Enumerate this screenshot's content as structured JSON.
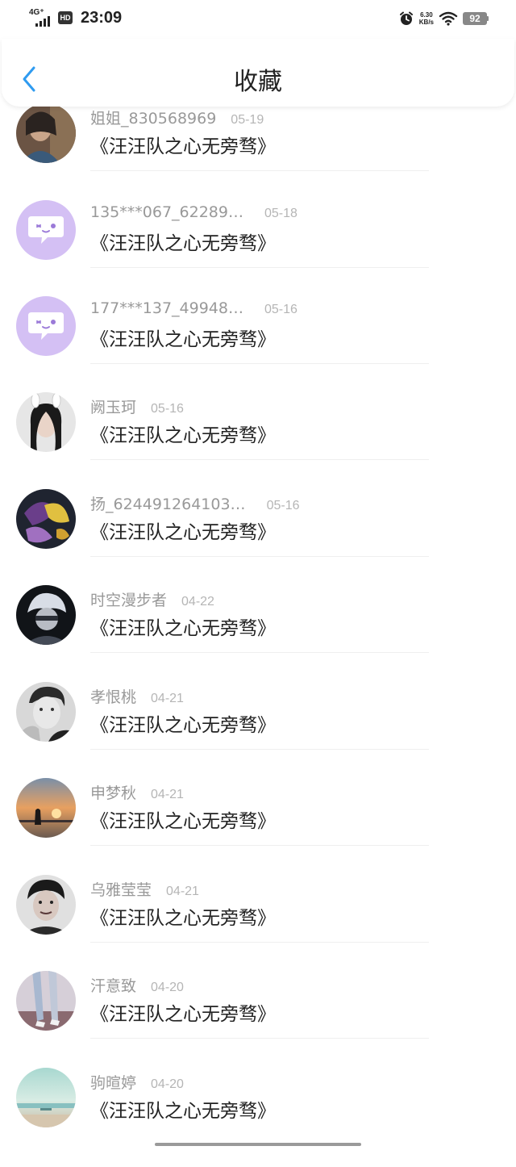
{
  "status_bar": {
    "network": "4G⁺",
    "hd": "HD",
    "time": "23:09",
    "speed_value": "6.30",
    "speed_unit": "KB/s",
    "battery": "92"
  },
  "header": {
    "title": "收藏",
    "back_icon": "chevron-left-icon"
  },
  "items": [
    {
      "name": "姐姐_830568969",
      "date": "05-19",
      "content": "《汪汪队之心无旁骛》",
      "avatar": "photo"
    },
    {
      "name": "135***067_62289…",
      "date": "05-18",
      "content": "《汪汪队之心无旁骛》",
      "avatar": "default"
    },
    {
      "name": "177***137_49948…",
      "date": "05-16",
      "content": "《汪汪队之心无旁骛》",
      "avatar": "default"
    },
    {
      "name": "阙玉珂",
      "date": "05-16",
      "content": "《汪汪队之心无旁骛》",
      "avatar": "photo"
    },
    {
      "name": "扬_624491264103…",
      "date": "05-16",
      "content": "《汪汪队之心无旁骛》",
      "avatar": "photo"
    },
    {
      "name": "时空漫步者",
      "date": "04-22",
      "content": "《汪汪队之心无旁骛》",
      "avatar": "photo"
    },
    {
      "name": "孝恨桃",
      "date": "04-21",
      "content": "《汪汪队之心无旁骛》",
      "avatar": "photo"
    },
    {
      "name": "申梦秋",
      "date": "04-21",
      "content": "《汪汪队之心无旁骛》",
      "avatar": "photo"
    },
    {
      "name": "乌雅莹莹",
      "date": "04-21",
      "content": "《汪汪队之心无旁骛》",
      "avatar": "photo"
    },
    {
      "name": "汗意致",
      "date": "04-20",
      "content": "《汪汪队之心无旁骛》",
      "avatar": "photo"
    },
    {
      "name": "驹暄婷",
      "date": "04-20",
      "content": "《汪汪队之心无旁骛》",
      "avatar": "photo"
    }
  ],
  "colors": {
    "accent": "#2f9bf0",
    "default_avatar": "#d4c0f4",
    "name_text": "#999999",
    "title_text": "#222222"
  }
}
